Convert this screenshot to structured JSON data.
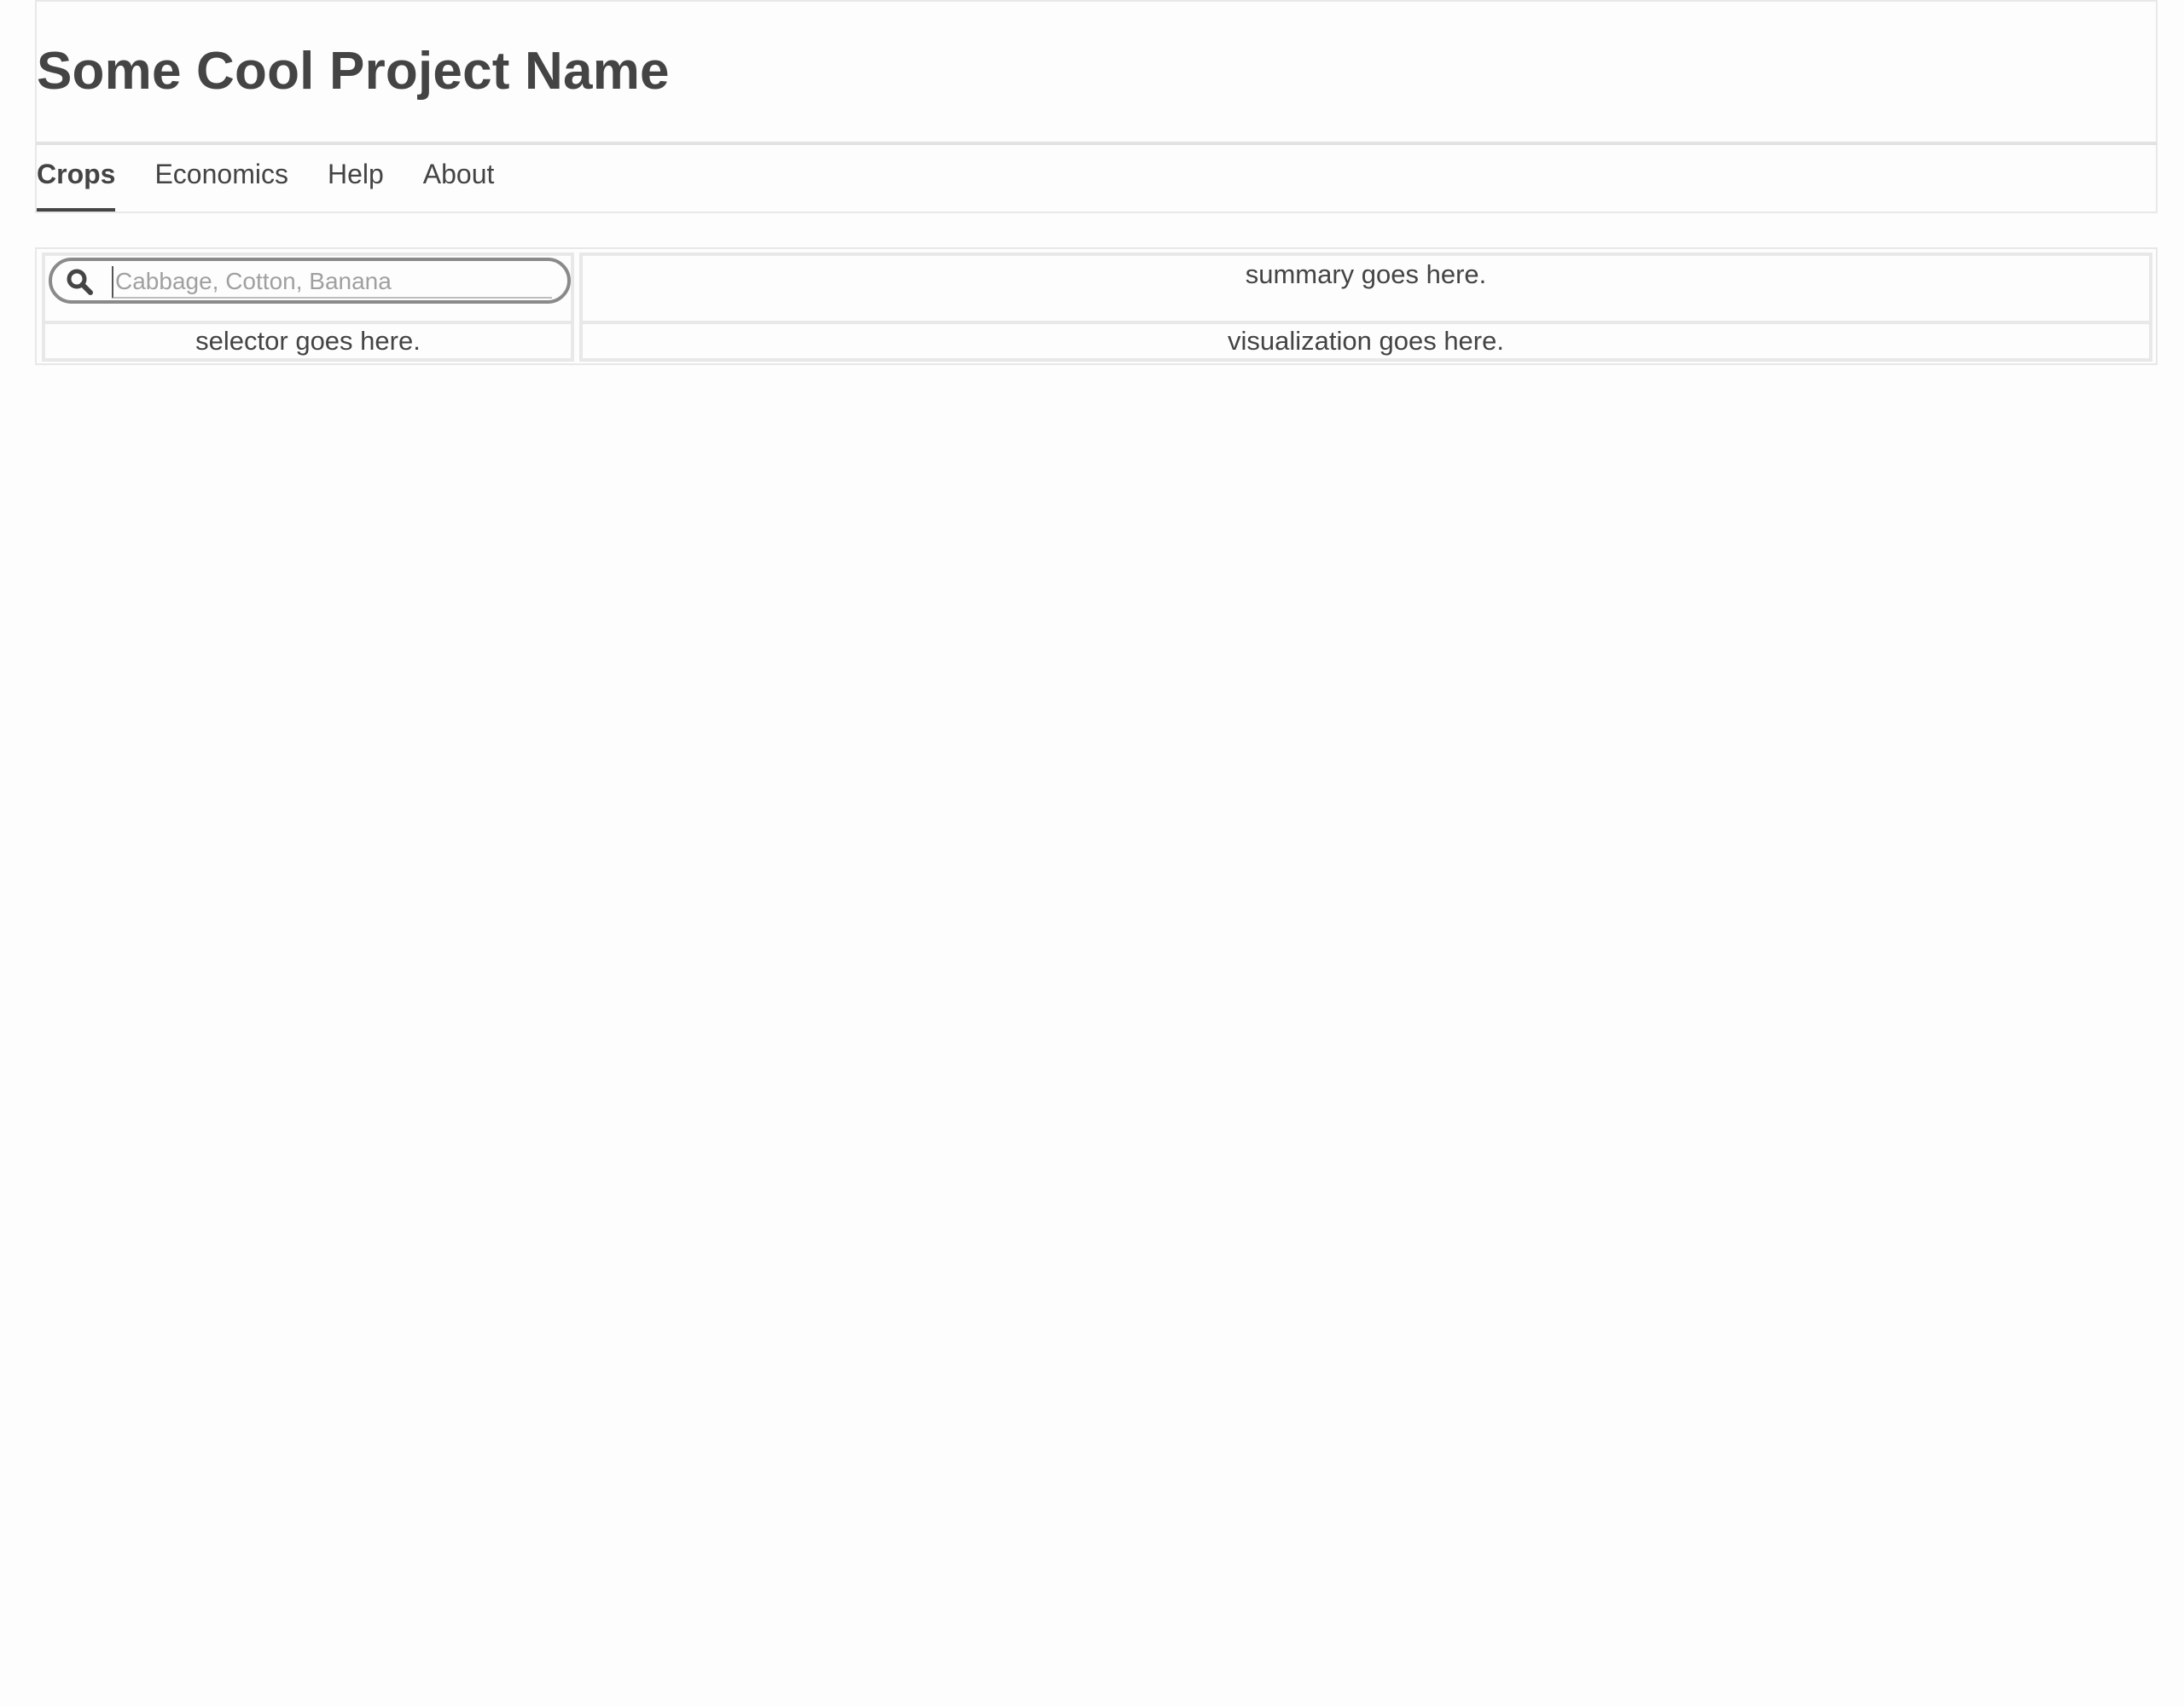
{
  "app": {
    "title": "Some Cool Project Name"
  },
  "nav": {
    "tabs": [
      {
        "label": "Crops",
        "active": true
      },
      {
        "label": "Economics",
        "active": false
      },
      {
        "label": "Help",
        "active": false
      },
      {
        "label": "About",
        "active": false
      }
    ]
  },
  "search": {
    "icon": "search-icon",
    "value": "",
    "placeholder": "Cabbage, Cotton, Banana"
  },
  "panels": {
    "summary": "summary goes here.",
    "selector": "selector goes here.",
    "visualization": "visualization goes here."
  },
  "colors": {
    "text": "#444444",
    "border": "#e8e8e8",
    "search_border": "#8a8a8a",
    "placeholder": "#a0a0a0"
  }
}
